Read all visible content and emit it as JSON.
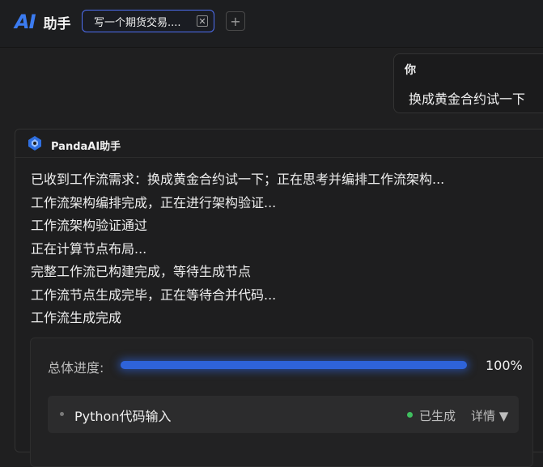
{
  "header": {
    "logo_text": "AI",
    "title": "助手",
    "tab_label": "写一个期货交易....",
    "tab_close_icon": "close-icon",
    "add_tab_icon": "plus-icon",
    "add_tab_glyph": "+",
    "close_glyph": "✕"
  },
  "user_message": {
    "sender": "你",
    "text": "换成黄金合约试一下"
  },
  "assistant": {
    "name": "PandaAI助手",
    "log_lines": [
      "已收到工作流需求：换成黄金合约试一下；正在思考并编排工作流架构...",
      "工作流架构编排完成，正在进行架构验证...",
      "工作流架构验证通过",
      "正在计算节点布局...",
      "完整工作流已构建完成，等待生成节点",
      "工作流节点生成完毕，正在等待合并代码...",
      "工作流生成完成"
    ],
    "progress": {
      "label": "总体进度:",
      "value": 1.0,
      "percent_text": "100%"
    },
    "nodes": [
      {
        "name": "Python代码输入",
        "status": "已生成",
        "status_color": "#3fbf5f",
        "detail_label": "详情",
        "detail_icon": "triangle-down-icon"
      }
    ]
  },
  "colors": {
    "accent": "#2e63d9",
    "logo_blue": "#3b7bf0",
    "tab_border": "#4e6ef2"
  }
}
